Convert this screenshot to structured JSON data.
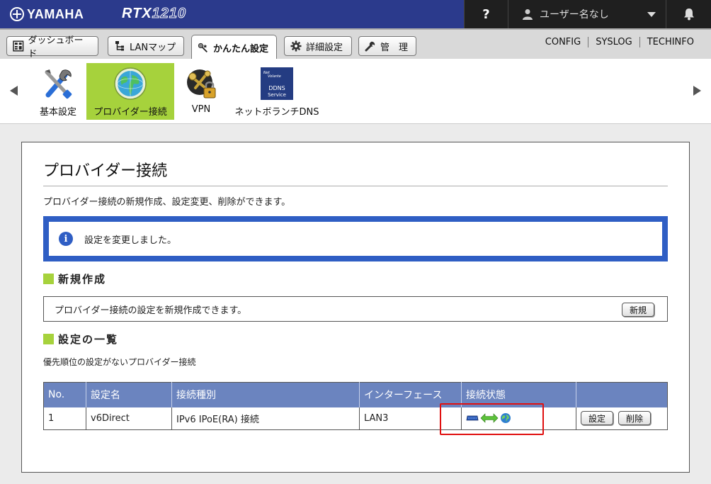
{
  "header": {
    "brand": "YAMAHA",
    "model_prefix": "RTX",
    "model_number": "1210",
    "help_label": "?",
    "user_label": "ユーザー名なし"
  },
  "tabs": [
    {
      "label": "ダッシュボード",
      "icon": "dashboard-icon"
    },
    {
      "label": "LANマップ",
      "icon": "lan-map-icon"
    },
    {
      "label": "かんたん設定",
      "icon": "wand-icon",
      "active": true
    },
    {
      "label": "詳細設定",
      "icon": "gear-icon"
    },
    {
      "label": "管　理",
      "icon": "wrench-icon"
    }
  ],
  "system_links": [
    "CONFIG",
    "SYSLOG",
    "TECHINFO"
  ],
  "icon_bar": {
    "items": [
      {
        "label": "基本設定",
        "icon": "tools-icon"
      },
      {
        "label": "プロバイダー接続",
        "icon": "globe-icon",
        "selected": true
      },
      {
        "label": "VPN",
        "icon": "vpn-keys-icon"
      },
      {
        "label": "ネットボランチDNS",
        "icon": "ddns-icon"
      }
    ],
    "ddns_icon_lines": [
      "Net",
      "Volante",
      "DDNS",
      "Service"
    ]
  },
  "page": {
    "title": "プロバイダー接続",
    "description": "プロバイダー接続の新規作成、設定変更、削除ができます。",
    "notice": "設定を変更しました。",
    "new_section": {
      "heading": "新規作成",
      "text": "プロバイダー接続の設定を新規作成できます。",
      "button": "新規"
    },
    "list_section": {
      "heading": "設定の一覧",
      "subtext": "優先順位の設定がないプロバイダー接続",
      "columns": [
        "No.",
        "設定名",
        "接続種別",
        "インターフェース",
        "接続状態",
        ""
      ],
      "rows": [
        {
          "no": "1",
          "name": "v6Direct",
          "type": "IPv6 IPoE(RA) 接続",
          "interface": "LAN3",
          "status": "connected",
          "edit": "設定",
          "delete": "削除"
        }
      ]
    }
  },
  "colors": {
    "header_bg": "#2b3a8c",
    "accent_green": "#a6d23c",
    "notice_blue": "#2f5ec4",
    "table_header": "#6b84bf",
    "highlight_red": "#e01010"
  }
}
